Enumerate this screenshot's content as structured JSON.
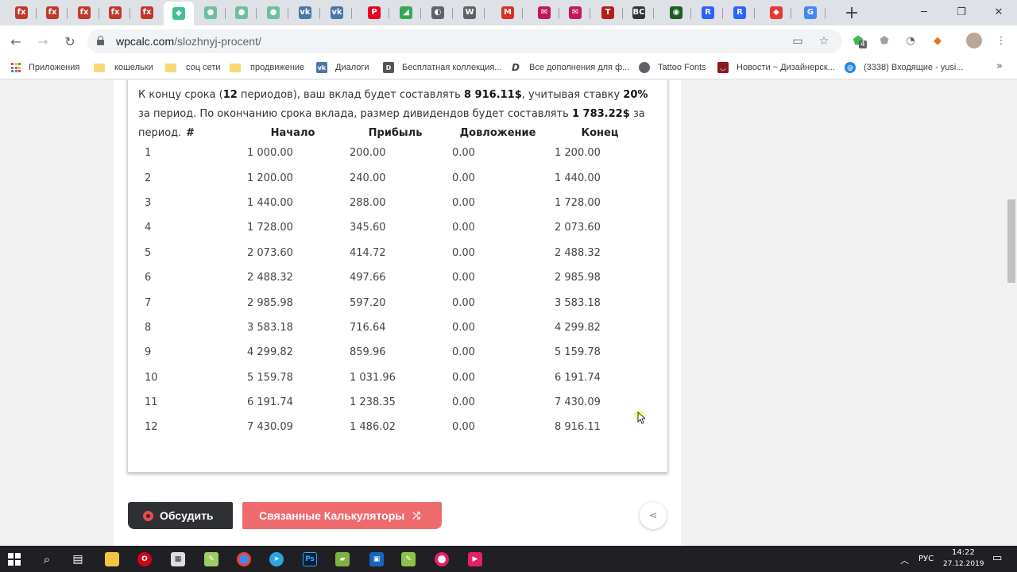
{
  "browser": {
    "url_host": "wpcalc.com",
    "url_path": "/slozhnyj-procent/",
    "tabs": [
      {
        "icon": "fx-icon",
        "glyph": "fx",
        "color": "#c0392b"
      },
      {
        "icon": "fx-icon",
        "glyph": "fx",
        "color": "#c0392b"
      },
      {
        "icon": "fx-icon",
        "glyph": "fx",
        "color": "#c0392b"
      },
      {
        "icon": "fx-icon",
        "glyph": "fx",
        "color": "#c0392b"
      },
      {
        "icon": "fx-icon",
        "glyph": "fx",
        "color": "#c0392b"
      },
      {
        "icon": "calculator-leaf-icon",
        "glyph": "◆",
        "color": "#3ec28f"
      },
      {
        "icon": "chrome-ext-icon",
        "glyph": "●",
        "color": "#6dbf9b"
      },
      {
        "icon": "chrome-ext-icon",
        "glyph": "●",
        "color": "#6dbf9b"
      },
      {
        "icon": "chrome-ext-icon",
        "glyph": "●",
        "color": "#6dbf9b"
      },
      {
        "icon": "vk-icon",
        "glyph": "vk",
        "color": "#4a76a8"
      },
      {
        "icon": "vk-icon",
        "glyph": "vk",
        "color": "#4a76a8"
      },
      {
        "icon": "pinterest-icon",
        "glyph": "P",
        "color": "#e60023"
      },
      {
        "icon": "maps-icon",
        "glyph": "◢",
        "color": "#34a853"
      },
      {
        "icon": "globe-icon",
        "glyph": "◐",
        "color": "#5f6368"
      },
      {
        "icon": "wordpress-icon",
        "glyph": "W",
        "color": "#5f6368"
      },
      {
        "icon": "gmail-icon",
        "glyph": "M",
        "color": "#d93025"
      },
      {
        "icon": "mail-ext-icon",
        "glyph": "✉",
        "color": "#c2185b"
      },
      {
        "icon": "mail-ext-icon",
        "glyph": "✉",
        "color": "#c2185b"
      },
      {
        "icon": "tattoo-icon",
        "glyph": "T",
        "color": "#b71c1c"
      },
      {
        "icon": "bc-icon",
        "glyph": "BC",
        "color": "#333333"
      },
      {
        "icon": "green-circle-icon",
        "glyph": "◉",
        "color": "#1b5e20"
      },
      {
        "icon": "r-brand-icon",
        "glyph": "R",
        "color": "#2962ff"
      },
      {
        "icon": "r-brand-icon",
        "glyph": "R",
        "color": "#2962ff"
      },
      {
        "icon": "pin-icon",
        "glyph": "◆",
        "color": "#e53935"
      },
      {
        "icon": "google-icon",
        "glyph": "G",
        "color": "#4285f4"
      }
    ],
    "extension_badge": "4"
  },
  "bookmarks": [
    {
      "label": "Приложения",
      "icon": "apps-grid-icon"
    },
    {
      "label": "кошельки",
      "icon": "folder-icon"
    },
    {
      "label": "соц сети",
      "icon": "folder-icon"
    },
    {
      "label": "продвижение",
      "icon": "folder-icon"
    },
    {
      "label": "Диалоги",
      "icon": "vk-icon"
    },
    {
      "label": "Бесплатная коллекция...",
      "icon": "df-icon"
    },
    {
      "label": "Все дополнения для ф...",
      "icon": "d-script-icon"
    },
    {
      "label": "Tattoo Fonts",
      "icon": "globe-icon"
    },
    {
      "label": "Новости ~ Дизайнерск...",
      "icon": "design-news-icon"
    },
    {
      "label": "(3338) Входящие - yusi...",
      "icon": "mail-at-icon"
    }
  ],
  "summary": {
    "p1": "К концу срока (",
    "periods": "12",
    "p2": " периодов), ваш вклад будет составлять ",
    "final_amount": "8 916.11$",
    "p3": ", учитывая ставку ",
    "rate": "20%",
    "p4": " за период. По окончанию срока вклада, размер дивидендов будет составлять ",
    "dividend": "1 783.22$",
    "p5": " за период."
  },
  "table": {
    "headers": [
      "#",
      "Начало",
      "Прибыль",
      "Довложение",
      "Конец"
    ],
    "rows": [
      [
        "1",
        "1 000.00",
        "200.00",
        "0.00",
        "1 200.00"
      ],
      [
        "2",
        "1 200.00",
        "240.00",
        "0.00",
        "1 440.00"
      ],
      [
        "3",
        "1 440.00",
        "288.00",
        "0.00",
        "1 728.00"
      ],
      [
        "4",
        "1 728.00",
        "345.60",
        "0.00",
        "2 073.60"
      ],
      [
        "5",
        "2 073.60",
        "414.72",
        "0.00",
        "2 488.32"
      ],
      [
        "6",
        "2 488.32",
        "497.66",
        "0.00",
        "2 985.98"
      ],
      [
        "7",
        "2 985.98",
        "597.20",
        "0.00",
        "3 583.18"
      ],
      [
        "8",
        "3 583.18",
        "716.64",
        "0.00",
        "4 299.82"
      ],
      [
        "9",
        "4 299.82",
        "859.96",
        "0.00",
        "5 159.78"
      ],
      [
        "10",
        "5 159.78",
        "1 031.96",
        "0.00",
        "6 191.74"
      ],
      [
        "11",
        "6 191.74",
        "1 238.35",
        "0.00",
        "7 430.09"
      ],
      [
        "12",
        "7 430.09",
        "1 486.02",
        "0.00",
        "8 916.11"
      ]
    ]
  },
  "actions": {
    "discuss_label": "Обсудить",
    "related_label": "Связанные Калькуляторы"
  },
  "taskbar": {
    "lang": "РУС",
    "time": "14:22",
    "date": "27.12.2019"
  }
}
